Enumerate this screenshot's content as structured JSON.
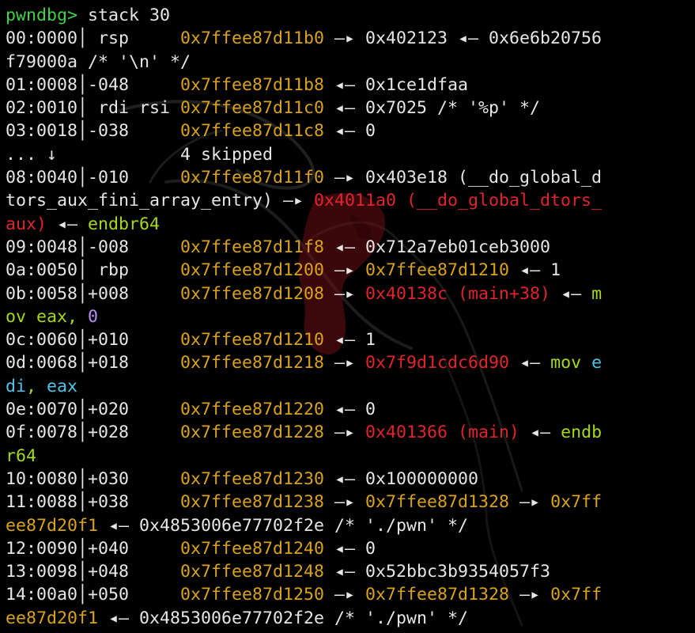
{
  "app": {
    "prompt": "pwndbg>",
    "command": "stack 30"
  },
  "colors": {
    "background": "#000000",
    "text": "#e6e6e6",
    "prompt": "#3fd14a",
    "stack_address": "#d9a21b",
    "code_address": "#e0242d",
    "instruction": "#a6d81a",
    "immediate": "#b98cf2",
    "register": "#4fc3e8"
  },
  "output": {
    "lines": [
      [
        {
          "c": "prompt",
          "t": "pwndbg>"
        },
        {
          "c": "cmd",
          "t": " stack 30"
        }
      ],
      [
        {
          "c": "plain",
          "t": "00:0000│ rsp     "
        },
        {
          "c": "addr",
          "t": "0x7ffee87d11b0"
        },
        {
          "c": "plain",
          "t": " —▸ 0x402123 ◂— 0x6e6b20756"
        }
      ],
      [
        {
          "c": "plain",
          "t": "f79000a /* '\\n' */"
        }
      ],
      [
        {
          "c": "plain",
          "t": "01:0008│-048     "
        },
        {
          "c": "addr",
          "t": "0x7ffee87d11b8"
        },
        {
          "c": "plain",
          "t": " ◂— 0x1ce1dfaa"
        }
      ],
      [
        {
          "c": "plain",
          "t": "02:0010│ rdi rsi "
        },
        {
          "c": "addr",
          "t": "0x7ffee87d11c0"
        },
        {
          "c": "plain",
          "t": " ◂— 0x7025 /* '%p' */"
        }
      ],
      [
        {
          "c": "plain",
          "t": "03:0018│-038     "
        },
        {
          "c": "addr",
          "t": "0x7ffee87d11c8"
        },
        {
          "c": "plain",
          "t": " ◂— 0"
        }
      ],
      [
        {
          "c": "plain",
          "t": "... ↓            4 skipped"
        }
      ],
      [
        {
          "c": "plain",
          "t": "08:0040│-010     "
        },
        {
          "c": "addr",
          "t": "0x7ffee87d11f0"
        },
        {
          "c": "plain",
          "t": " —▸ 0x403e18 (__do_global_d"
        }
      ],
      [
        {
          "c": "plain",
          "t": "tors_aux_fini_array_entry) —▸ "
        },
        {
          "c": "code",
          "t": "0x4011a0 (__do_global_dtors_"
        }
      ],
      [
        {
          "c": "code",
          "t": "aux)"
        },
        {
          "c": "plain",
          "t": " ◂— "
        },
        {
          "c": "instr",
          "t": "endbr64"
        }
      ],
      [
        {
          "c": "plain",
          "t": "09:0048│-008     "
        },
        {
          "c": "addr",
          "t": "0x7ffee87d11f8"
        },
        {
          "c": "plain",
          "t": " ◂— 0x712a7eb01ceb3000"
        }
      ],
      [
        {
          "c": "plain",
          "t": "0a:0050│ rbp     "
        },
        {
          "c": "addr",
          "t": "0x7ffee87d1200"
        },
        {
          "c": "plain",
          "t": " —▸ "
        },
        {
          "c": "addr",
          "t": "0x7ffee87d1210"
        },
        {
          "c": "plain",
          "t": " ◂— 1"
        }
      ],
      [
        {
          "c": "plain",
          "t": "0b:0058│+008     "
        },
        {
          "c": "addr",
          "t": "0x7ffee87d1208"
        },
        {
          "c": "plain",
          "t": " —▸ "
        },
        {
          "c": "code",
          "t": "0x40138c (main+38)"
        },
        {
          "c": "plain",
          "t": " ◂— "
        },
        {
          "c": "instr",
          "t": "m"
        }
      ],
      [
        {
          "c": "instr",
          "t": "ov eax, "
        },
        {
          "c": "num",
          "t": "0"
        }
      ],
      [
        {
          "c": "plain",
          "t": "0c:0060│+010     "
        },
        {
          "c": "addr",
          "t": "0x7ffee87d1210"
        },
        {
          "c": "plain",
          "t": " ◂— 1"
        }
      ],
      [
        {
          "c": "plain",
          "t": "0d:0068│+018     "
        },
        {
          "c": "addr",
          "t": "0x7ffee87d1218"
        },
        {
          "c": "plain",
          "t": " —▸ "
        },
        {
          "c": "code",
          "t": "0x7f9d1cdc6d90"
        },
        {
          "c": "plain",
          "t": " ◂— "
        },
        {
          "c": "instr",
          "t": "mov "
        },
        {
          "c": "cyan",
          "t": "e"
        }
      ],
      [
        {
          "c": "cyan",
          "t": "di"
        },
        {
          "c": "instr",
          "t": ", "
        },
        {
          "c": "cyan",
          "t": "eax"
        }
      ],
      [
        {
          "c": "plain",
          "t": "0e:0070│+020     "
        },
        {
          "c": "addr",
          "t": "0x7ffee87d1220"
        },
        {
          "c": "plain",
          "t": " ◂— 0"
        }
      ],
      [
        {
          "c": "plain",
          "t": "0f:0078│+028     "
        },
        {
          "c": "addr",
          "t": "0x7ffee87d1228"
        },
        {
          "c": "plain",
          "t": " —▸ "
        },
        {
          "c": "code",
          "t": "0x401366 (main)"
        },
        {
          "c": "plain",
          "t": " ◂— "
        },
        {
          "c": "instr",
          "t": "endb"
        }
      ],
      [
        {
          "c": "instr",
          "t": "r64"
        }
      ],
      [
        {
          "c": "plain",
          "t": "10:0080│+030     "
        },
        {
          "c": "addr",
          "t": "0x7ffee87d1230"
        },
        {
          "c": "plain",
          "t": " ◂— 0x100000000"
        }
      ],
      [
        {
          "c": "plain",
          "t": "11:0088│+038     "
        },
        {
          "c": "addr",
          "t": "0x7ffee87d1238"
        },
        {
          "c": "plain",
          "t": " —▸ "
        },
        {
          "c": "addr",
          "t": "0x7ffee87d1328"
        },
        {
          "c": "plain",
          "t": " —▸ "
        },
        {
          "c": "addr",
          "t": "0x7ff"
        }
      ],
      [
        {
          "c": "addr",
          "t": "ee87d20f1"
        },
        {
          "c": "plain",
          "t": " ◂— 0x4853006e77702f2e /* './pwn' */"
        }
      ],
      [
        {
          "c": "plain",
          "t": "12:0090│+040     "
        },
        {
          "c": "addr",
          "t": "0x7ffee87d1240"
        },
        {
          "c": "plain",
          "t": " ◂— 0"
        }
      ],
      [
        {
          "c": "plain",
          "t": "13:0098│+048     "
        },
        {
          "c": "addr",
          "t": "0x7ffee87d1248"
        },
        {
          "c": "plain",
          "t": " ◂— 0x52bbc3b9354057f3"
        }
      ],
      [
        {
          "c": "plain",
          "t": "14:00a0│+050     "
        },
        {
          "c": "addr",
          "t": "0x7ffee87d1250"
        },
        {
          "c": "plain",
          "t": " —▸ "
        },
        {
          "c": "addr",
          "t": "0x7ffee87d1328"
        },
        {
          "c": "plain",
          "t": " —▸ "
        },
        {
          "c": "addr",
          "t": "0x7ff"
        }
      ],
      [
        {
          "c": "addr",
          "t": "ee87d20f1"
        },
        {
          "c": "plain",
          "t": " ◂— 0x4853006e77702f2e /* './pwn' */"
        }
      ]
    ]
  },
  "wallpaper": {
    "icon": "kali-dragon-icon"
  }
}
